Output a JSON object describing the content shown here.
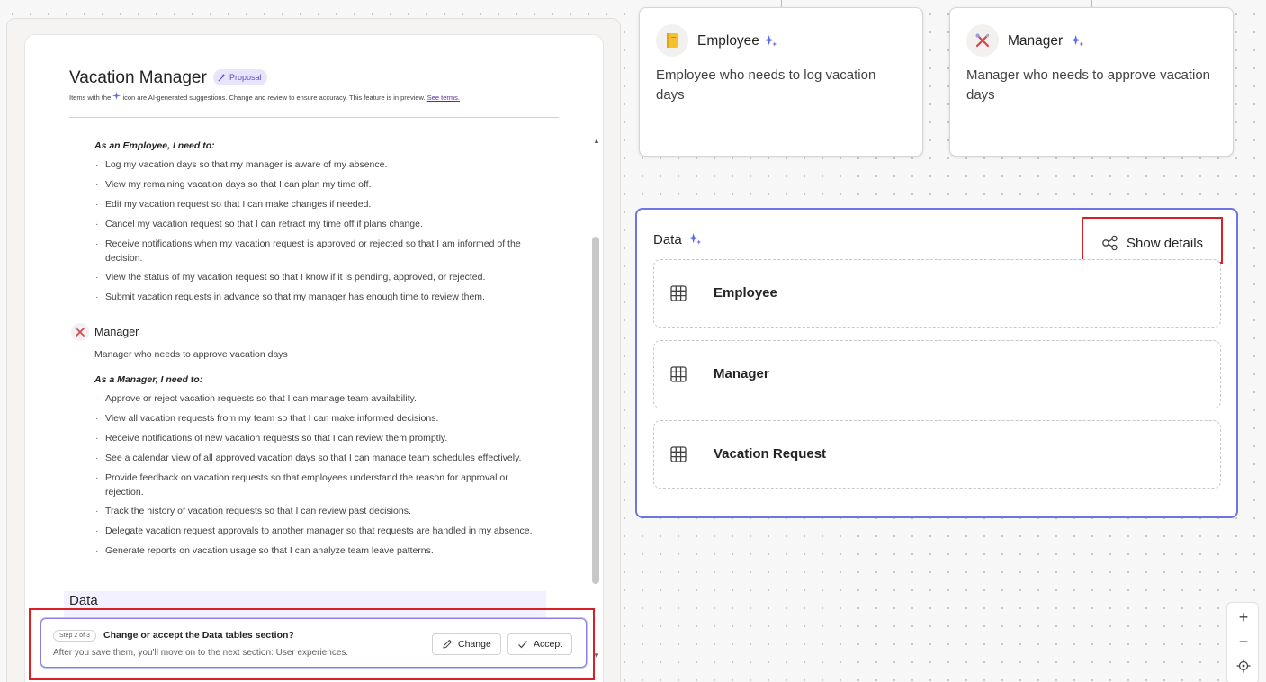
{
  "doc": {
    "title": "Vacation Manager",
    "badge": "Proposal",
    "ai_note_prefix": "Items with the",
    "ai_note_middle": "icon are AI-generated suggestions. Change and review to ensure accuracy. This feature is in preview.",
    "ai_note_link": "See terms.",
    "employee_need_heading": "As an Employee, I need to:",
    "employee_needs": [
      "Log my vacation days so that my manager is aware of my absence.",
      "View my remaining vacation days so that I can plan my time off.",
      "Edit my vacation request so that I can make changes if needed.",
      "Cancel my vacation request so that I can retract my time off if plans change.",
      "Receive notifications when my vacation request is approved or rejected so that I am informed of the decision.",
      "View the status of my vacation request so that I know if it is pending, approved, or rejected.",
      "Submit vacation requests in advance so that my manager has enough time to review them."
    ],
    "manager_name": "Manager",
    "manager_desc": "Manager who needs to approve vacation days",
    "manager_need_heading": "As a Manager, I need to:",
    "manager_needs": [
      "Approve or reject vacation requests so that I can manage team availability.",
      "View all vacation requests from my team so that I can make informed decisions.",
      "Receive notifications of new vacation requests so that I can review them promptly.",
      "See a calendar view of all approved vacation days so that I can manage team schedules effectively.",
      "Provide feedback on vacation requests so that employees understand the reason for approval or rejection.",
      "Track the history of vacation requests so that I can review past decisions.",
      "Delegate vacation request approvals to another manager so that requests are handled in my absence.",
      "Generate reports on vacation usage so that I can analyze team leave patterns."
    ],
    "data_heading": "Data"
  },
  "step": {
    "pill": "Step 2 of 3",
    "title": "Change or accept the Data tables section?",
    "subtitle": "After you save them, you'll move on to the next section: User experiences.",
    "change_label": "Change",
    "accept_label": "Accept"
  },
  "personas": [
    {
      "name": "Employee",
      "desc": "Employee who needs to log vacation days",
      "icon": "notebook-icon"
    },
    {
      "name": "Manager",
      "desc": "Manager who needs to approve vacation days",
      "icon": "manager-tools-icon"
    }
  ],
  "data_card": {
    "title": "Data",
    "show_details_label": "Show details",
    "tables": [
      "Employee",
      "Manager",
      "Vacation Request"
    ]
  },
  "zoom": {
    "in": "+",
    "out": "−"
  },
  "colors": {
    "accent": "#6e73e6",
    "highlight": "#d92027",
    "sparkle": "#5b6ee8"
  }
}
